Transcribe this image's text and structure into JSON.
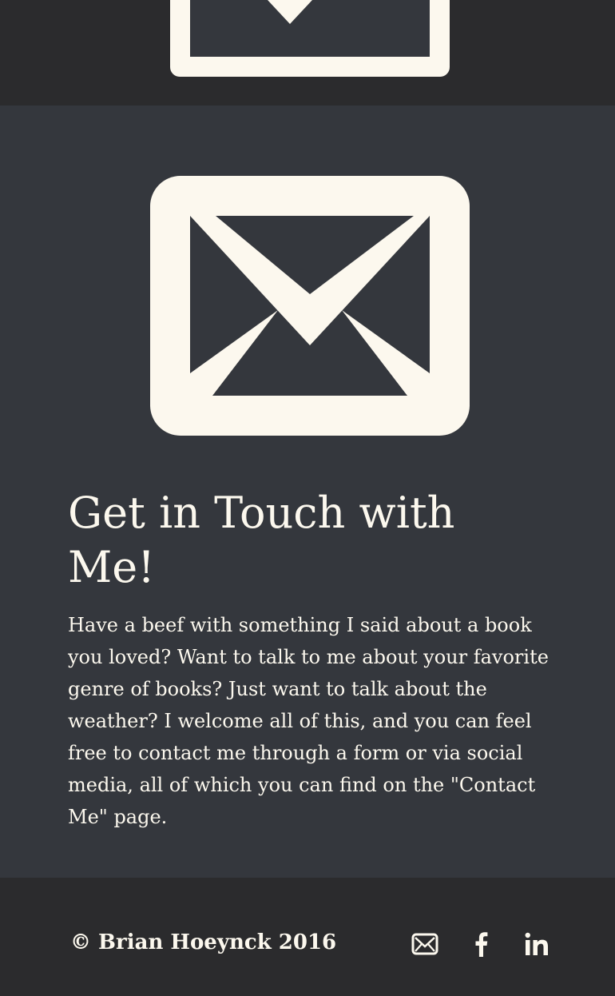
{
  "contact": {
    "title": "Get in Touch with Me!",
    "text": "Have a beef with something I said about a book you loved? Want to talk to me about your favorite genre of books? Just want to talk about the weather? I welcome all of this, and you can feel free to contact me through a form or via social media, all of which you can find on the \"Contact Me\" page."
  },
  "footer": {
    "copyright": "© Brian Hoeynck 2016",
    "social_icons": [
      "mail-icon",
      "facebook-icon",
      "linkedin-icon"
    ]
  },
  "colors": {
    "band_dark": "#2b2b2d",
    "section_bg": "#34373d",
    "cream": "#fcf8ee"
  }
}
